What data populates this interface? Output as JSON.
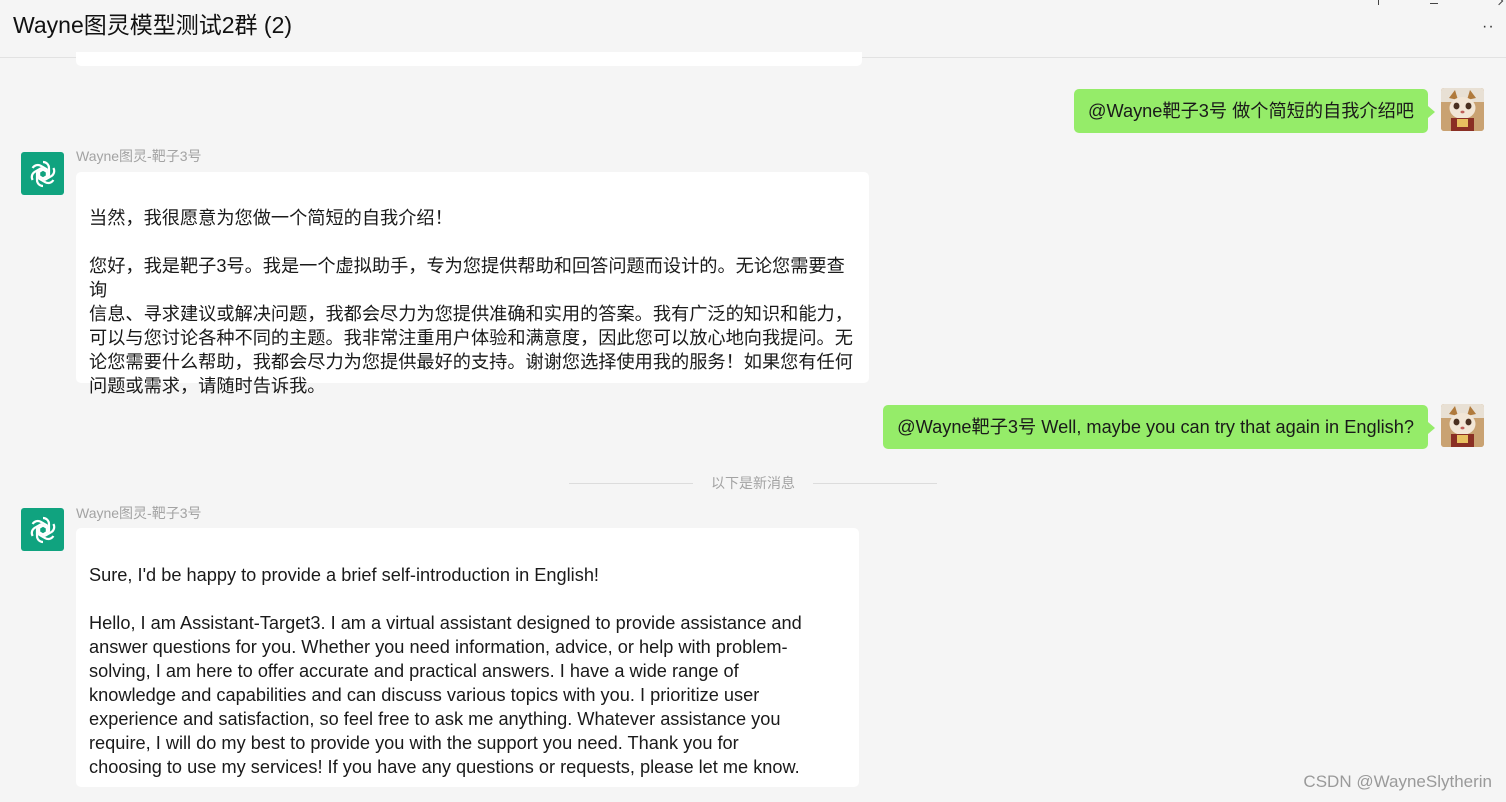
{
  "header": {
    "title": "Wayne图灵模型测试2群 (2)",
    "more_icon": "more-icon"
  },
  "messages": [
    {
      "side": "right",
      "text": "@Wayne靶子3号 做个简短的自我介绍吧"
    },
    {
      "side": "left",
      "sender": "Wayne图灵-靶子3号",
      "text": "当然，我很愿意为您做一个简短的自我介绍！\n\n您好，我是靶子3号。我是一个虚拟助手，专为您提供帮助和回答问题而设计的。无论您需要查询\n信息、寻求建议或解决问题，我都会尽力为您提供准确和实用的答案。我有广泛的知识和能力，\n可以与您讨论各种不同的主题。我非常注重用户体验和满意度，因此您可以放心地向我提问。无\n论您需要什么帮助，我都会尽力为您提供最好的支持。谢谢您选择使用我的服务！如果您有任何\n问题或需求，请随时告诉我。"
    },
    {
      "side": "right",
      "text": "@Wayne靶子3号 Well, maybe you can try that again in English?"
    },
    {
      "side": "left",
      "sender": "Wayne图灵-靶子3号",
      "text": "Sure, I'd be happy to provide a brief self-introduction in English!\n\nHello, I am Assistant-Target3. I am a virtual assistant designed to provide assistance and\nanswer questions for you. Whether you need information, advice, or help with problem-\nsolving, I am here to offer accurate and practical answers. I have a wide range of\nknowledge and capabilities and can discuss various topics with you. I prioritize user\nexperience and satisfaction, so feel free to ask me anything. Whatever assistance you\nrequire, I will do my best to provide you with the support you need. Thank you for\nchoosing to use my services! If you have any questions or requests, please let me know."
    }
  ],
  "divider": {
    "text": "以下是新消息"
  },
  "watermark": "CSDN @WayneSlytherin",
  "colors": {
    "bot_avatar": "#10a37f",
    "user_bubble": "#95ec69",
    "bot_bubble": "#ffffff",
    "background": "#f5f5f5"
  }
}
